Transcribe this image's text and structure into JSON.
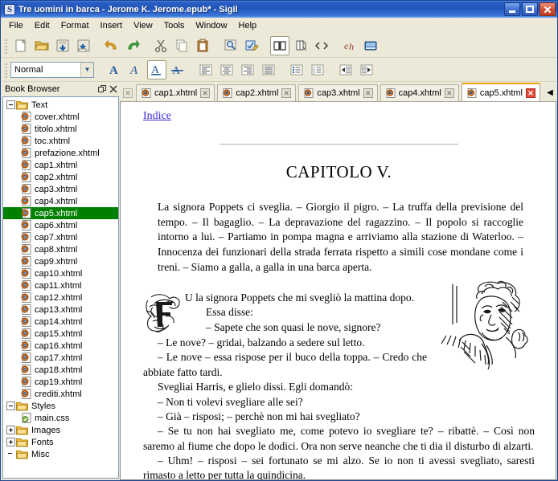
{
  "window": {
    "title": "Tre uomini in barca - Jerome K. Jerome.epub* - Sigil",
    "app_icon": "S",
    "controls": {
      "minimize": "minimize-button",
      "maximize": "maximize-button",
      "close": "close-button"
    }
  },
  "menu": {
    "items": [
      "File",
      "Edit",
      "Format",
      "Insert",
      "View",
      "Tools",
      "Window",
      "Help"
    ]
  },
  "toolbar_main": {
    "buttons": [
      {
        "name": "new-file-button",
        "icon": "new-document-icon",
        "title": "New"
      },
      {
        "name": "open-file-button",
        "icon": "open-folder-icon",
        "title": "Open"
      },
      {
        "name": "save-button",
        "icon": "save-disk-icon",
        "title": "Save"
      },
      {
        "name": "save-as-button",
        "icon": "save-as-icon",
        "title": "Save As"
      },
      {
        "name": "undo-button",
        "icon": "undo-arrow-icon",
        "title": "Undo"
      },
      {
        "name": "redo-button",
        "icon": "redo-arrow-icon",
        "title": "Redo"
      },
      {
        "name": "cut-button",
        "icon": "scissors-icon",
        "title": "Cut"
      },
      {
        "name": "copy-button",
        "icon": "copy-pages-icon",
        "title": "Copy"
      },
      {
        "name": "paste-button",
        "icon": "clipboard-icon",
        "title": "Paste"
      },
      {
        "name": "find-replace-button",
        "icon": "magnifier-icon",
        "title": "Find & Replace"
      },
      {
        "name": "spellcheck-button",
        "icon": "spellcheck-pencil-icon",
        "title": "Spellcheck"
      },
      {
        "name": "book-view-button",
        "icon": "open-book-icon",
        "title": "Book View",
        "pressed": true
      },
      {
        "name": "split-view-button",
        "icon": "split-page-icon",
        "title": "Split View"
      },
      {
        "name": "code-view-button",
        "icon": "code-brackets-icon",
        "title": "Code View"
      },
      {
        "name": "special-character-button",
        "icon": "eh-glyph-icon",
        "title": "Insert Special Character"
      },
      {
        "name": "preview-button",
        "icon": "preview-window-icon",
        "title": "Preview"
      }
    ]
  },
  "toolbar_format": {
    "style_combo": {
      "value": "Normal",
      "name": "paragraph-style-select"
    },
    "buttons": [
      {
        "name": "bold-button",
        "icon": "bold-a-icon",
        "title": "Bold"
      },
      {
        "name": "italic-button",
        "icon": "italic-a-icon",
        "title": "Italic"
      },
      {
        "name": "underline-button",
        "icon": "underline-a-icon",
        "title": "Underline",
        "pressed": true
      },
      {
        "name": "strikethrough-button",
        "icon": "strikethrough-a-icon",
        "title": "Strikethrough"
      },
      {
        "name": "align-left-button",
        "icon": "align-left-icon",
        "title": "Align Left"
      },
      {
        "name": "align-center-button",
        "icon": "align-center-icon",
        "title": "Align Center"
      },
      {
        "name": "align-right-button",
        "icon": "align-right-icon",
        "title": "Align Right"
      },
      {
        "name": "align-justify-button",
        "icon": "align-justify-icon",
        "title": "Justify"
      },
      {
        "name": "bullet-list-button",
        "icon": "bullet-list-icon",
        "title": "Bullet List"
      },
      {
        "name": "numbered-list-button",
        "icon": "numbered-list-icon",
        "title": "Numbered List"
      },
      {
        "name": "decrease-indent-button",
        "icon": "outdent-arrow-icon",
        "title": "Decrease Indent"
      },
      {
        "name": "increase-indent-button",
        "icon": "indent-arrow-icon",
        "title": "Increase Indent"
      }
    ]
  },
  "book_browser": {
    "title": "Book Browser",
    "float_button": "undock-icon",
    "close_button": "close-icon",
    "tree": [
      {
        "label": "Text",
        "type": "folder",
        "expanded": true,
        "level": 0
      },
      {
        "label": "cover.xhtml",
        "type": "file",
        "level": 1
      },
      {
        "label": "titolo.xhtml",
        "type": "file",
        "level": 1
      },
      {
        "label": "toc.xhtml",
        "type": "file",
        "level": 1
      },
      {
        "label": "prefazione.xhtml",
        "type": "file",
        "level": 1
      },
      {
        "label": "cap1.xhtml",
        "type": "file",
        "level": 1
      },
      {
        "label": "cap2.xhtml",
        "type": "file",
        "level": 1
      },
      {
        "label": "cap3.xhtml",
        "type": "file",
        "level": 1
      },
      {
        "label": "cap4.xhtml",
        "type": "file",
        "level": 1
      },
      {
        "label": "cap5.xhtml",
        "type": "file",
        "level": 1,
        "selected": true
      },
      {
        "label": "cap6.xhtml",
        "type": "file",
        "level": 1
      },
      {
        "label": "cap7.xhtml",
        "type": "file",
        "level": 1
      },
      {
        "label": "cap8.xhtml",
        "type": "file",
        "level": 1
      },
      {
        "label": "cap9.xhtml",
        "type": "file",
        "level": 1
      },
      {
        "label": "cap10.xhtml",
        "type": "file",
        "level": 1
      },
      {
        "label": "cap11.xhtml",
        "type": "file",
        "level": 1
      },
      {
        "label": "cap12.xhtml",
        "type": "file",
        "level": 1
      },
      {
        "label": "cap13.xhtml",
        "type": "file",
        "level": 1
      },
      {
        "label": "cap14.xhtml",
        "type": "file",
        "level": 1
      },
      {
        "label": "cap15.xhtml",
        "type": "file",
        "level": 1
      },
      {
        "label": "cap16.xhtml",
        "type": "file",
        "level": 1
      },
      {
        "label": "cap17.xhtml",
        "type": "file",
        "level": 1
      },
      {
        "label": "cap18.xhtml",
        "type": "file",
        "level": 1
      },
      {
        "label": "cap19.xhtml",
        "type": "file",
        "level": 1
      },
      {
        "label": "crediti.xhtml",
        "type": "file",
        "level": 1
      },
      {
        "label": "Styles",
        "type": "folder",
        "expanded": true,
        "level": 0
      },
      {
        "label": "main.css",
        "type": "css",
        "level": 1
      },
      {
        "label": "Images",
        "type": "folder",
        "expanded": false,
        "level": 0
      },
      {
        "label": "Fonts",
        "type": "folder",
        "expanded": false,
        "level": 0
      },
      {
        "label": "Misc",
        "type": "folder",
        "level": 0
      }
    ]
  },
  "tabs": {
    "items": [
      {
        "label": "cap1.xhtml",
        "active": false
      },
      {
        "label": "cap2.xhtml",
        "active": false
      },
      {
        "label": "cap3.xhtml",
        "active": false
      },
      {
        "label": "cap4.xhtml",
        "active": false
      },
      {
        "label": "cap5.xhtml",
        "active": true
      }
    ],
    "close_glyph": "✕",
    "scroll_left_glyph": "◀",
    "active_accent": "#f0a30a",
    "active_close_color": "#e44a3a"
  },
  "document": {
    "index_link": "Indice",
    "chapter_title": "CAPITOLO V.",
    "summary": "La signora Poppets ci sveglia. – Giorgio il pigro. – La truffa della previsione del tempo. – Il bagaglio. – La depravazione del ragazzino. – Il popolo si raccoglie intorno a lui. – Partiamo in pompa magna e arriviamo alla stazione di Waterloo. – Innocenza dei funzionari della strada ferrata rispetto a simili cose mondane come i treni. – Siamo a galla, a galla in una barca aperta.",
    "dropcap_letter": "F",
    "paragraphs": [
      "U la signora Poppets che mi svegliò la mattina dopo.",
      "Essa disse:",
      "– Sapete che son quasi le nove, signore?",
      "– Le nove? – gridai, balzando a sedere sul letto.",
      "– Le nove – essa rispose per il buco della toppa. – Credo che abbiate fatto tardi.",
      "Svegliai Harris, e glielo dissi. Egli domandò:",
      "– Non ti volevi svegliare alle sei?",
      "– Già – risposi; – perchè non mi hai svegliato?",
      "– Se tu non hai svegliato me, come potevo io svegliare te? – ribattè. – Così non saremo al fiume che dopo le dodici. Ora non serve neanche che ti dia il disturbo di alzarti.",
      "– Uhm! – risposi – sei fortunato se mi alzo. Se io non ti avessi svegliato, saresti rimasto a letto per tutta la quindicina."
    ],
    "illustration_name": "mrs-poppets-engraving"
  }
}
